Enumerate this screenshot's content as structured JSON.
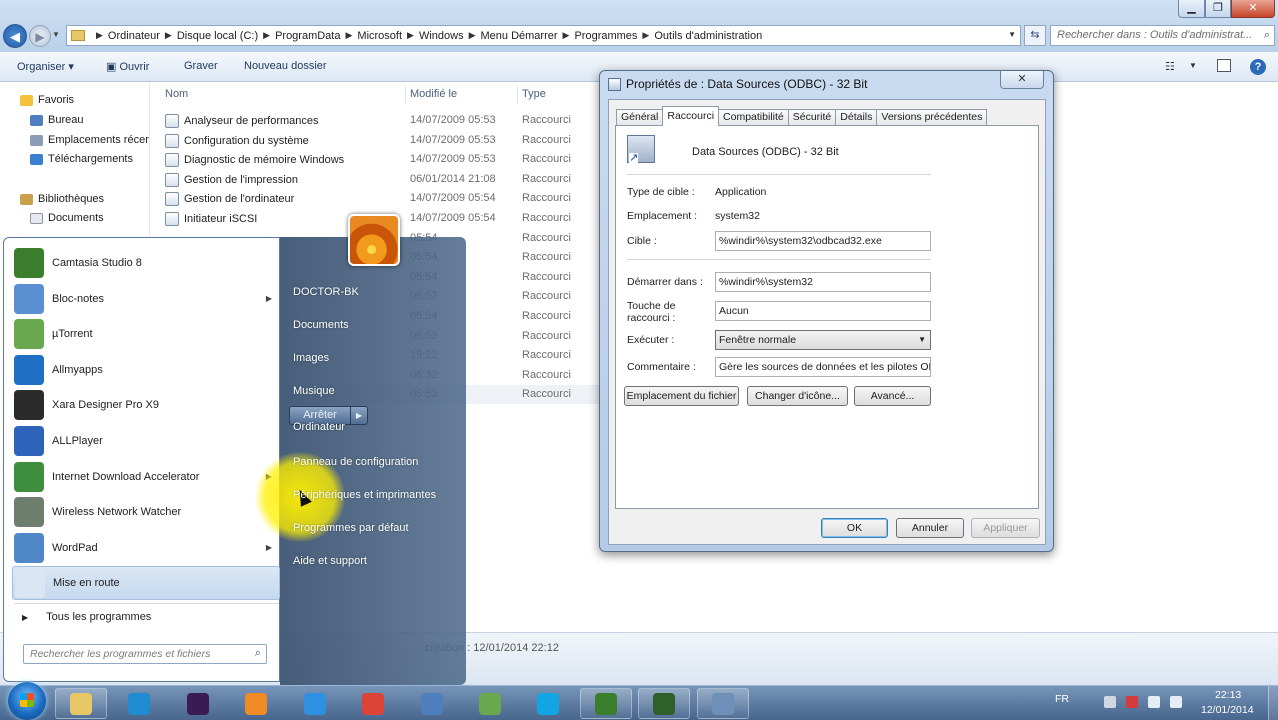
{
  "explorer": {
    "breadcrumbs": [
      "Ordinateur",
      "Disque local (C:)",
      "ProgramData",
      "Microsoft",
      "Windows",
      "Menu Démarrer",
      "Programmes",
      "Outils d'administration"
    ],
    "search_placeholder": "Rechercher dans : Outils d'administrat...",
    "toolbar": {
      "organize": "Organiser ▾",
      "open": "Ouvrir",
      "burn": "Graver",
      "new_folder": "Nouveau dossier"
    },
    "nav": {
      "favorites": "Favoris",
      "desktop": "Bureau",
      "recent": "Emplacements récer",
      "downloads": "Téléchargements",
      "libraries": "Bibliothèques",
      "documents": "Documents"
    },
    "columns": {
      "name": "Nom",
      "modified": "Modifié le",
      "type": "Type"
    },
    "files": [
      {
        "name": "Analyseur de performances",
        "date": "14/07/2009 05:53",
        "type": "Raccourci"
      },
      {
        "name": "Configuration du système",
        "date": "14/07/2009 05:53",
        "type": "Raccourci"
      },
      {
        "name": "Diagnostic de mémoire Windows",
        "date": "14/07/2009 05:53",
        "type": "Raccourci"
      },
      {
        "name": "Gestion de l'impression",
        "date": "06/01/2014 21:08",
        "type": "Raccourci"
      },
      {
        "name": "Gestion de l'ordinateur",
        "date": "14/07/2009 05:54",
        "type": "Raccourci"
      },
      {
        "name": "Initiateur iSCSI",
        "date": "14/07/2009 05:54",
        "type": "Raccourci"
      },
      {
        "name": "",
        "date": "05:54",
        "type": "Raccourci"
      },
      {
        "name": "",
        "date": "05:54",
        "type": "Raccourci"
      },
      {
        "name": "",
        "date": "05:54",
        "type": "Raccourci"
      },
      {
        "name": "",
        "date": "05:57",
        "type": "Raccourci"
      },
      {
        "name": "",
        "date": "05:54",
        "type": "Raccourci"
      },
      {
        "name": "",
        "date": "05:53",
        "type": "Raccourci"
      },
      {
        "name": "",
        "date": "19:22",
        "type": "Raccourci"
      },
      {
        "name": "",
        "date": "06:32",
        "type": "Raccourci"
      },
      {
        "name": "",
        "date": "05:53",
        "type": "Raccourci"
      }
    ],
    "details": "création : 12/01/2014 22:12"
  },
  "startmenu": {
    "apps": [
      {
        "label": "Camtasia Studio 8",
        "color": "#3a7d2c",
        "submenu": false
      },
      {
        "label": "Bloc-notes",
        "color": "#5b8fd1",
        "submenu": true
      },
      {
        "label": "µTorrent",
        "color": "#6aa84f",
        "submenu": false
      },
      {
        "label": "Allmyapps",
        "color": "#1f6fc4",
        "submenu": false
      },
      {
        "label": "Xara Designer Pro X9",
        "color": "#2b2b2b",
        "submenu": false
      },
      {
        "label": "ALLPlayer",
        "color": "#2d63b8",
        "submenu": false
      },
      {
        "label": "Internet Download Accelerator",
        "color": "#3f8e3f",
        "submenu": true
      },
      {
        "label": "Wireless Network Watcher",
        "color": "#6f7f6f",
        "submenu": false
      },
      {
        "label": "WordPad",
        "color": "#4f87c7",
        "submenu": true
      },
      {
        "label": "Mise en route",
        "color": "#d9e6f4",
        "submenu": false
      }
    ],
    "all_programs": "Tous les programmes",
    "search_placeholder": "Rechercher les programmes et fichiers",
    "places": [
      "DOCTOR-BK",
      "Documents",
      "Images",
      "Musique",
      "Ordinateur",
      "Panneau de configuration",
      "Périphériques et imprimantes",
      "Programmes par défaut",
      "Aide et support"
    ],
    "shutdown": "Arrêter"
  },
  "dialog": {
    "title": "Propriétés de : Data Sources (ODBC) - 32 Bit",
    "tabs": [
      "Général",
      "Raccourci",
      "Compatibilité",
      "Sécurité",
      "Détails",
      "Versions précédentes"
    ],
    "active_tab": 1,
    "shortcut_name": "Data Sources (ODBC) - 32 Bit",
    "labels": {
      "target_type": "Type de cible :",
      "location": "Emplacement :",
      "target": "Cible :",
      "start_in": "Démarrer dans :",
      "shortcut_key_1": "Touche de",
      "shortcut_key_2": "raccourci :",
      "run": "Exécuter :",
      "comment": "Commentaire :"
    },
    "values": {
      "target_type": "Application",
      "location": "system32",
      "target": "%windir%\\system32\\odbcad32.exe",
      "start_in": "%windir%\\system32",
      "shortcut_key": "Aucun",
      "run": "Fenêtre normale",
      "comment": "Gère les sources de données et les pilotes ODB"
    },
    "buttons": {
      "open_location": "Emplacement du fichier",
      "change_icon": "Changer d'icône...",
      "advanced": "Avancé...",
      "ok": "OK",
      "cancel": "Annuler",
      "apply": "Appliquer"
    }
  },
  "taskbar": {
    "apps": [
      {
        "name": "explorer",
        "color": "#e8c766"
      },
      {
        "name": "outlook",
        "color": "#1f8bd1"
      },
      {
        "name": "premiere",
        "color": "#3b1b54"
      },
      {
        "name": "media-player",
        "color": "#f08a24"
      },
      {
        "name": "internet-explorer",
        "color": "#2f8fe0"
      },
      {
        "name": "chrome",
        "color": "#db4437"
      },
      {
        "name": "network",
        "color": "#4f7fbf"
      },
      {
        "name": "utorrent",
        "color": "#6aa84f"
      },
      {
        "name": "skype",
        "color": "#12a5e3"
      },
      {
        "name": "camtasia-recorder",
        "color": "#3a7d2c"
      },
      {
        "name": "camtasia-studio",
        "color": "#2f5f2a"
      },
      {
        "name": "control-panel",
        "color": "#6e8fb8"
      }
    ],
    "lang": "FR",
    "time": "22:13",
    "date": "12/01/2014"
  }
}
